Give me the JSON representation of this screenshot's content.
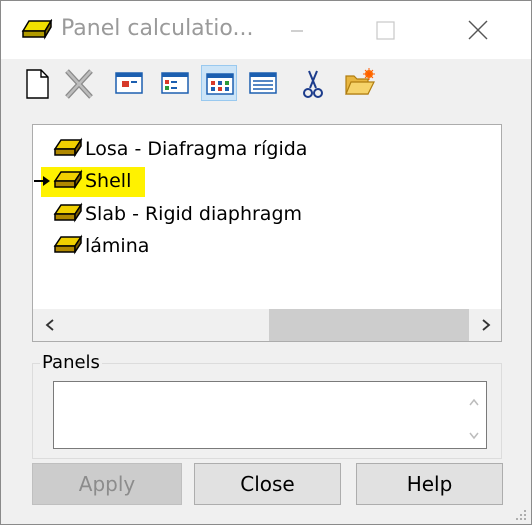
{
  "window": {
    "title": "Panel calculatio...",
    "icon": "panel-yellow-icon"
  },
  "titlebar_buttons": [
    "minimize-icon",
    "maximize-icon",
    "close-icon"
  ],
  "toolbar": {
    "buttons": [
      {
        "name": "new",
        "icon": "new-document-icon",
        "enabled": true
      },
      {
        "name": "delete",
        "icon": "delete-x-icon",
        "enabled": false
      },
      {
        "name": "view-large",
        "icon": "large-icons-view-icon",
        "enabled": true
      },
      {
        "name": "view-small",
        "icon": "small-icons-view-icon",
        "enabled": true
      },
      {
        "name": "view-list",
        "icon": "list-view-icon",
        "enabled": true,
        "active": true
      },
      {
        "name": "view-details",
        "icon": "details-view-icon",
        "enabled": true
      },
      {
        "name": "cut",
        "icon": "scissors-icon",
        "enabled": true
      },
      {
        "name": "open",
        "icon": "folder-open-icon",
        "enabled": true
      }
    ]
  },
  "list": {
    "items": [
      {
        "label": "Losa - Diafragma rígida",
        "current": false,
        "highlighted": false
      },
      {
        "label": "Shell",
        "current": true,
        "highlighted": true
      },
      {
        "label": "Slab - Rigid diaphragm",
        "current": false,
        "highlighted": false
      },
      {
        "label": "lámina",
        "current": false,
        "highlighted": false
      }
    ],
    "highlight_color": "#fff200"
  },
  "panels_group": {
    "label": "Panels",
    "value": ""
  },
  "buttons": {
    "apply": "Apply",
    "close": "Close",
    "help": "Help"
  }
}
